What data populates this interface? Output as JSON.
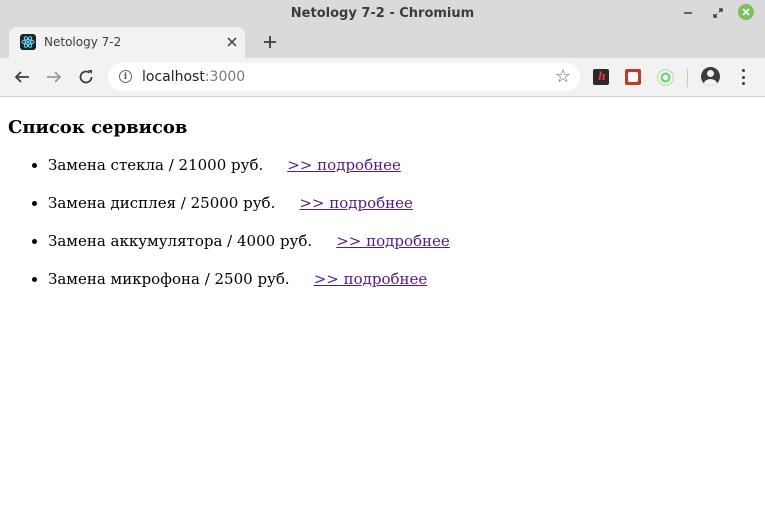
{
  "window": {
    "title": "Netology 7-2 - Chromium"
  },
  "tab": {
    "title": "Netology 7-2"
  },
  "address_bar": {
    "host": "localhost",
    "port": ":3000"
  },
  "page": {
    "heading": "Список сервисов",
    "services": [
      {
        "text": "Замена стекла / 21000 руб.",
        "link": ">> подробнее"
      },
      {
        "text": "Замена дисплея / 25000 руб.",
        "link": ">> подробнее"
      },
      {
        "text": "Замена аккумулятора / 4000 руб.",
        "link": ">> подробнее"
      },
      {
        "text": "Замена микрофона / 2500 руб.",
        "link": ">> подробнее"
      }
    ]
  },
  "colors": {
    "link_visited": "#551a8b",
    "chrome_frame": "#dadada",
    "toolbar": "#f2f2f2"
  },
  "icons": {
    "tab_favicon": "react-icon",
    "info": "info-icon",
    "bookmark": "star-icon",
    "profile": "profile-icon",
    "menu": "menu-icon"
  }
}
